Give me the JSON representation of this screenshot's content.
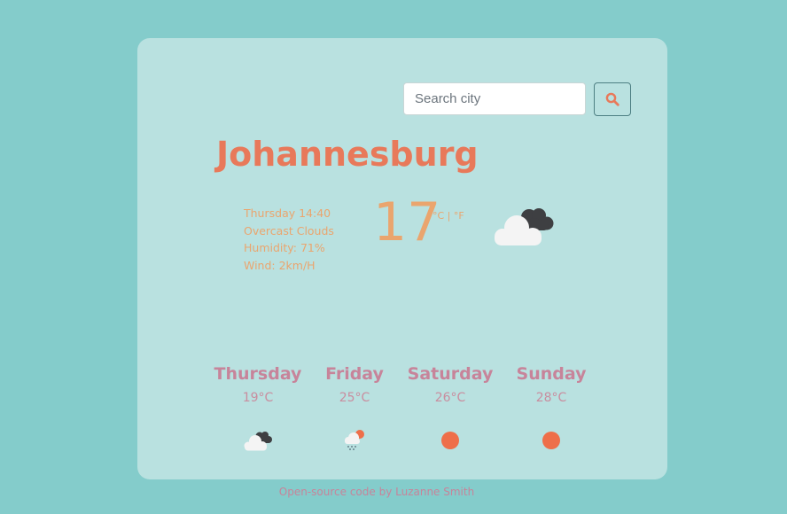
{
  "search": {
    "placeholder": "Search city",
    "button_icon": "search-icon"
  },
  "current": {
    "city": "Johannesburg",
    "datetime": "Thursday 14:40",
    "description": "Overcast Clouds",
    "humidity": "Humidity: 71%",
    "wind": "Wind: 2km/H",
    "temperature": "17",
    "unit_celsius": "°C",
    "unit_separator": " | ",
    "unit_fahrenheit": "°F",
    "icon": "overcast-clouds-icon"
  },
  "forecast": [
    {
      "day": "Thursday",
      "temp": "19°C",
      "icon": "overcast-clouds-icon"
    },
    {
      "day": "Friday",
      "temp": "25°C",
      "icon": "rain-sun-icon"
    },
    {
      "day": "Saturday",
      "temp": "26°C",
      "icon": "sun-icon"
    },
    {
      "day": "Sunday",
      "temp": "28°C",
      "icon": "sun-icon"
    }
  ],
  "footer": {
    "text": "Open-source code by Luzanne Smith"
  },
  "colors": {
    "page_background": "#84cccb",
    "card_background": "#b9e1e0",
    "accent": "#e8795a",
    "details": "#eaa56e",
    "forecast_text": "#c7849a",
    "sun": "#ee6f4a"
  }
}
